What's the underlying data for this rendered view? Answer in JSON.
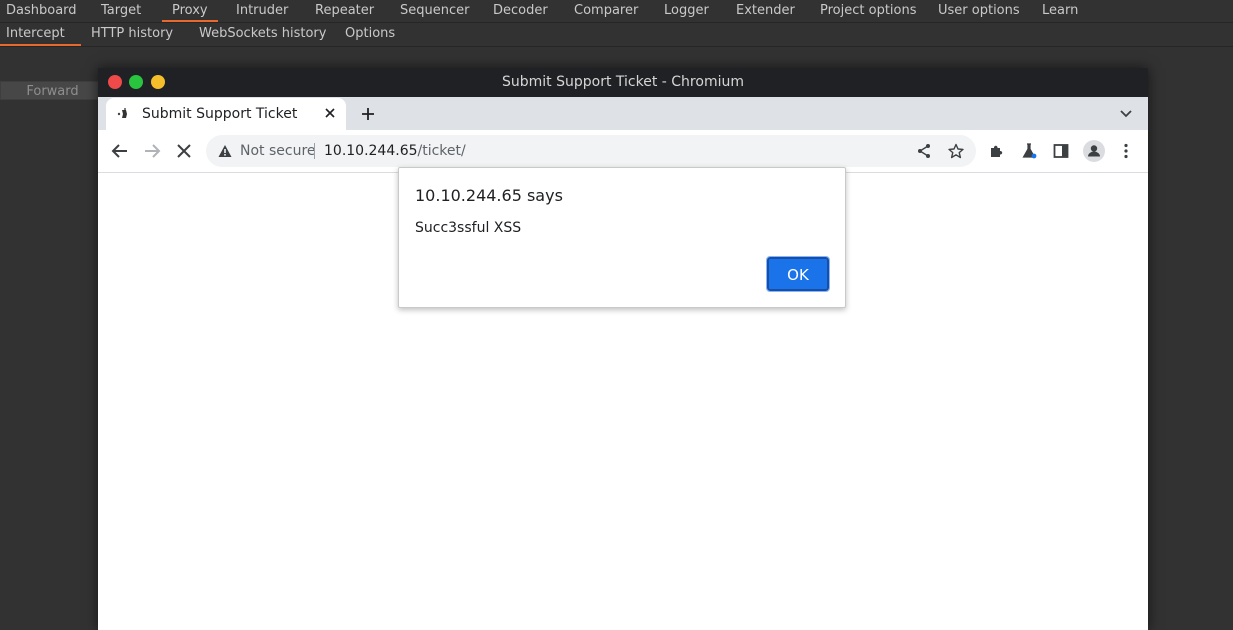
{
  "burp": {
    "menu": [
      "Dashboard",
      "Target",
      "Proxy",
      "Intruder",
      "Repeater",
      "Sequencer",
      "Decoder",
      "Comparer",
      "Logger",
      "Extender",
      "Project options",
      "User options",
      "Learn"
    ],
    "active_menu": "Proxy",
    "submenu": [
      "Intercept",
      "HTTP history",
      "WebSockets history",
      "Options"
    ],
    "active_submenu": "Intercept",
    "forward_label": "Forward",
    "accent_color": "#e8692e"
  },
  "browser": {
    "window_title": "Submit Support Ticket - Chromium",
    "tab_title": "Submit Support Ticket",
    "security_label": "Not secure",
    "url_host": "10.10.244.65",
    "url_path": "/ticket/"
  },
  "dialog": {
    "title": "10.10.244.65 says",
    "message": "Succ3ssful XSS",
    "ok_label": "OK",
    "button_color": "#1a73e8"
  }
}
